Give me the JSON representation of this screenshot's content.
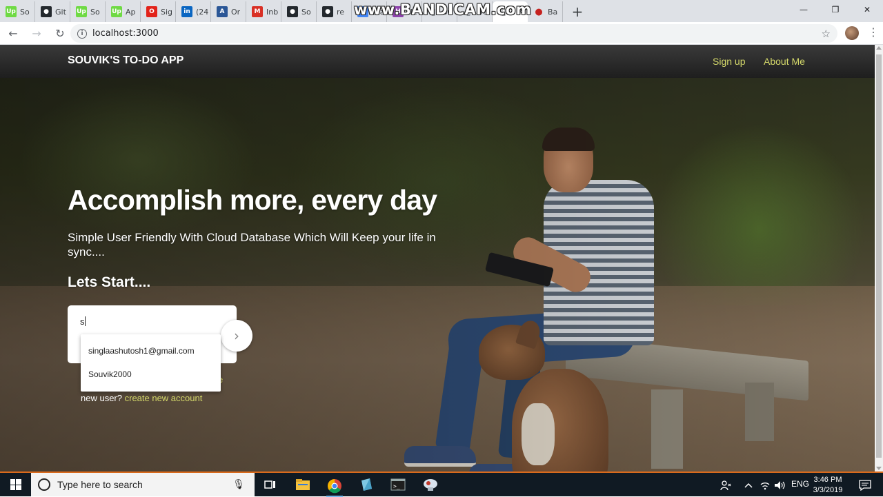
{
  "browser": {
    "tabs": [
      {
        "title": "So",
        "fav": "Up",
        "color": "#6fda44"
      },
      {
        "title": "Git",
        "fav": "gh",
        "color": "#24292e"
      },
      {
        "title": "So",
        "fav": "Up",
        "color": "#6fda44"
      },
      {
        "title": "Ap",
        "fav": "Up",
        "color": "#6fda44"
      },
      {
        "title": "Sig",
        "fav": "O",
        "color": "#e2231a"
      },
      {
        "title": "(24",
        "fav": "in",
        "color": "#0a66c2"
      },
      {
        "title": "Or",
        "fav": "A",
        "color": "#2b5797"
      },
      {
        "title": "Inb",
        "fav": "M",
        "color": "#d93025"
      },
      {
        "title": "So",
        "fav": "gh",
        "color": "#24292e"
      },
      {
        "title": "re",
        "fav": "gh",
        "color": "#24292e"
      },
      {
        "title": "sca",
        "fav": "G",
        "color": "#4285f4"
      },
      {
        "title": "He",
        "fav": "H",
        "color": "#8e44ad"
      },
      {
        "title": "BC",
        "fav": "doc",
        "color": "#9aa0a6"
      },
      {
        "title": "BC",
        "fav": "doc",
        "color": "#9aa0a6"
      },
      {
        "title": "",
        "fav": "doc",
        "color": "#9aa0a6",
        "active": true
      },
      {
        "title": "Ba",
        "fav": "rec",
        "color": "#c5221f"
      }
    ],
    "watermark": "www.BANDICAM.com",
    "url": "localhost:3000",
    "new_tab_glyph": "+",
    "back_glyph": "←",
    "forward_glyph": "→",
    "reload_glyph": "↻",
    "star_glyph": "☆",
    "menu_glyph": "⋮",
    "minimize_glyph": "—",
    "restore_glyph": "❐",
    "close_glyph": "✕"
  },
  "site": {
    "brand": "SOUVIK'S TO-DO APP",
    "nav": {
      "signup": "Sign up",
      "about": "About Me"
    },
    "hero_title": "Accomplish more, every day",
    "hero_subtitle": "Simple User Friendly With Cloud Database Which Will Keep your life in sync....",
    "lets_start": "Lets Start....",
    "login_input_value": "s",
    "go_glyph": "›",
    "autocomplete": [
      "singlaashutosh1@gmail.com",
      "Souvik2000"
    ],
    "hidden_link_tail": "e",
    "new_user_text": "new user?",
    "create_account_link": "create new account",
    "link_color": "#d4d86a"
  },
  "taskbar": {
    "search_placeholder": "Type here to search",
    "mic_glyph": "🎙",
    "language": "ENG",
    "time": "3:46 PM",
    "date": "3/3/2019",
    "accent": "#d96a1c"
  }
}
